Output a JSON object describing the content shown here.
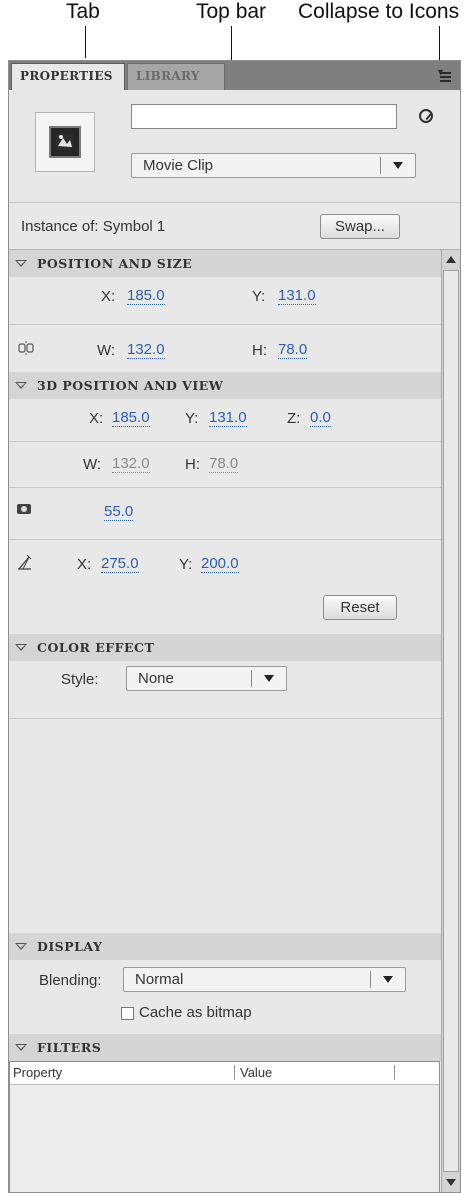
{
  "callouts": {
    "tab": "Tab",
    "top_bar": "Top bar",
    "collapse": "Collapse to Icons"
  },
  "tabs": [
    {
      "label": "PROPERTIES",
      "active": true
    },
    {
      "label": "LIBRARY",
      "active": false
    }
  ],
  "instance": {
    "name_value": "",
    "type_value": "Movie Clip",
    "instance_of_label": "Instance of:",
    "instance_of_value": "Symbol 1",
    "swap_label": "Swap..."
  },
  "position_size": {
    "title": "POSITION AND SIZE",
    "x_label": "X:",
    "x": "185.0",
    "y_label": "Y:",
    "y": "131.0",
    "w_label": "W:",
    "w": "132.0",
    "h_label": "H:",
    "h": "78.0"
  },
  "position_3d": {
    "title": "3D POSITION AND VIEW",
    "x_label": "X:",
    "x": "185.0",
    "y_label": "Y:",
    "y": "131.0",
    "z_label": "Z:",
    "z": "0.0",
    "w_label": "W:",
    "w": "132.0",
    "h_label": "H:",
    "h": "78.0",
    "perspective": "55.0",
    "vp_x_label": "X:",
    "vp_x": "275.0",
    "vp_y_label": "Y:",
    "vp_y": "200.0",
    "reset_label": "Reset"
  },
  "color_effect": {
    "title": "COLOR EFFECT",
    "style_label": "Style:",
    "style_value": "None"
  },
  "display": {
    "title": "DISPLAY",
    "blending_label": "Blending:",
    "blending_value": "Normal",
    "cache_label": "Cache as bitmap",
    "cache_checked": false
  },
  "filters": {
    "title": "FILTERS",
    "columns": [
      "Property",
      "Value"
    ]
  },
  "icons": {
    "collapse": "collapse-to-icons-icon",
    "edit": "edit-symbol-icon",
    "link": "link-constrain-icon",
    "camera": "camera-perspective-icon",
    "vanishing": "vanishing-point-icon"
  }
}
